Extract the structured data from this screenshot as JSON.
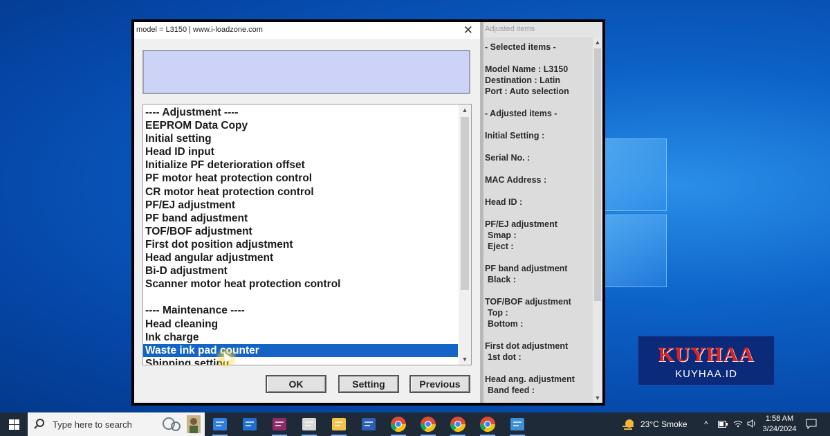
{
  "window": {
    "title": "model = L3150 | www.i-loadzone.com",
    "close_glyph": "✕"
  },
  "list": {
    "items": [
      {
        "label": "---- Adjustment ----",
        "kind": "header"
      },
      {
        "label": "EEPROM Data Copy",
        "kind": "item"
      },
      {
        "label": "Initial setting",
        "kind": "item"
      },
      {
        "label": "Head ID input",
        "kind": "item"
      },
      {
        "label": "Initialize PF deterioration offset",
        "kind": "item"
      },
      {
        "label": "PF motor heat protection control",
        "kind": "item"
      },
      {
        "label": "CR motor heat protection control",
        "kind": "item"
      },
      {
        "label": "PF/EJ adjustment",
        "kind": "item"
      },
      {
        "label": "PF band adjustment",
        "kind": "item"
      },
      {
        "label": "TOF/BOF adjustment",
        "kind": "item"
      },
      {
        "label": "First dot position adjustment",
        "kind": "item"
      },
      {
        "label": "Head angular adjustment",
        "kind": "item"
      },
      {
        "label": "Bi-D adjustment",
        "kind": "item"
      },
      {
        "label": "Scanner motor heat protection control",
        "kind": "item"
      },
      {
        "label": "",
        "kind": "blank"
      },
      {
        "label": "---- Maintenance ----",
        "kind": "header"
      },
      {
        "label": "Head cleaning",
        "kind": "item"
      },
      {
        "label": "Ink charge",
        "kind": "item"
      },
      {
        "label": "Waste ink pad counter",
        "kind": "item",
        "selected": true
      },
      {
        "label": "Shipping setting",
        "kind": "item"
      }
    ],
    "scroll_up": "▲",
    "scroll_down": "▼"
  },
  "buttons": {
    "ok": "OK",
    "setting": "Setting",
    "previous": "Previous"
  },
  "adjusted_panel": {
    "title": "Adjusted items",
    "lines": [
      {
        "text": " - Selected items -",
        "indent": false
      },
      {
        "text": "",
        "indent": false
      },
      {
        "text": "Model Name : L3150",
        "indent": false
      },
      {
        "text": "Destination : Latin",
        "indent": false
      },
      {
        "text": "Port : Auto selection",
        "indent": false
      },
      {
        "text": "",
        "indent": false
      },
      {
        "text": " - Adjusted items -",
        "indent": false
      },
      {
        "text": "",
        "indent": false
      },
      {
        "text": "Initial Setting :",
        "indent": false
      },
      {
        "text": "",
        "indent": false
      },
      {
        "text": "Serial No. :",
        "indent": false
      },
      {
        "text": "",
        "indent": false
      },
      {
        "text": "MAC Address :",
        "indent": false
      },
      {
        "text": "",
        "indent": false
      },
      {
        "text": "Head ID :",
        "indent": false
      },
      {
        "text": "",
        "indent": false
      },
      {
        "text": "PF/EJ adjustment",
        "indent": false
      },
      {
        "text": "Smap :",
        "indent": true
      },
      {
        "text": "Eject :",
        "indent": true
      },
      {
        "text": "",
        "indent": false
      },
      {
        "text": "PF band adjustment",
        "indent": false
      },
      {
        "text": "Black :",
        "indent": true
      },
      {
        "text": "",
        "indent": false
      },
      {
        "text": "TOF/BOF adjustment",
        "indent": false
      },
      {
        "text": "Top :",
        "indent": true
      },
      {
        "text": "Bottom :",
        "indent": true
      },
      {
        "text": "",
        "indent": false
      },
      {
        "text": "First dot adjustment",
        "indent": false
      },
      {
        "text": "1st dot :",
        "indent": true
      },
      {
        "text": "",
        "indent": false
      },
      {
        "text": "Head ang. adjustment",
        "indent": false
      },
      {
        "text": "Band feed :",
        "indent": true
      }
    ]
  },
  "watermark": {
    "big": "KUYHAA",
    "small": "KUYHAA.ID"
  },
  "taskbar": {
    "search_placeholder": "Type here to search",
    "weather": "23°C  Smoke",
    "time": "1:58 AM",
    "date": "3/24/2024",
    "apps": [
      "store-icon",
      "mail-icon",
      "winrar-icon",
      "paint-icon",
      "file-explorer-icon",
      "word-icon",
      "chrome-icon",
      "chrome-profile-a-icon",
      "chrome-profile-b-icon",
      "chrome-profile-k-icon",
      "control-panel-icon"
    ]
  },
  "colors": {
    "selection": "#1463c6",
    "info_box": "#cdd3f6",
    "watermark_red": "#e0201e",
    "watermark_bg": "#0b2a7a"
  }
}
